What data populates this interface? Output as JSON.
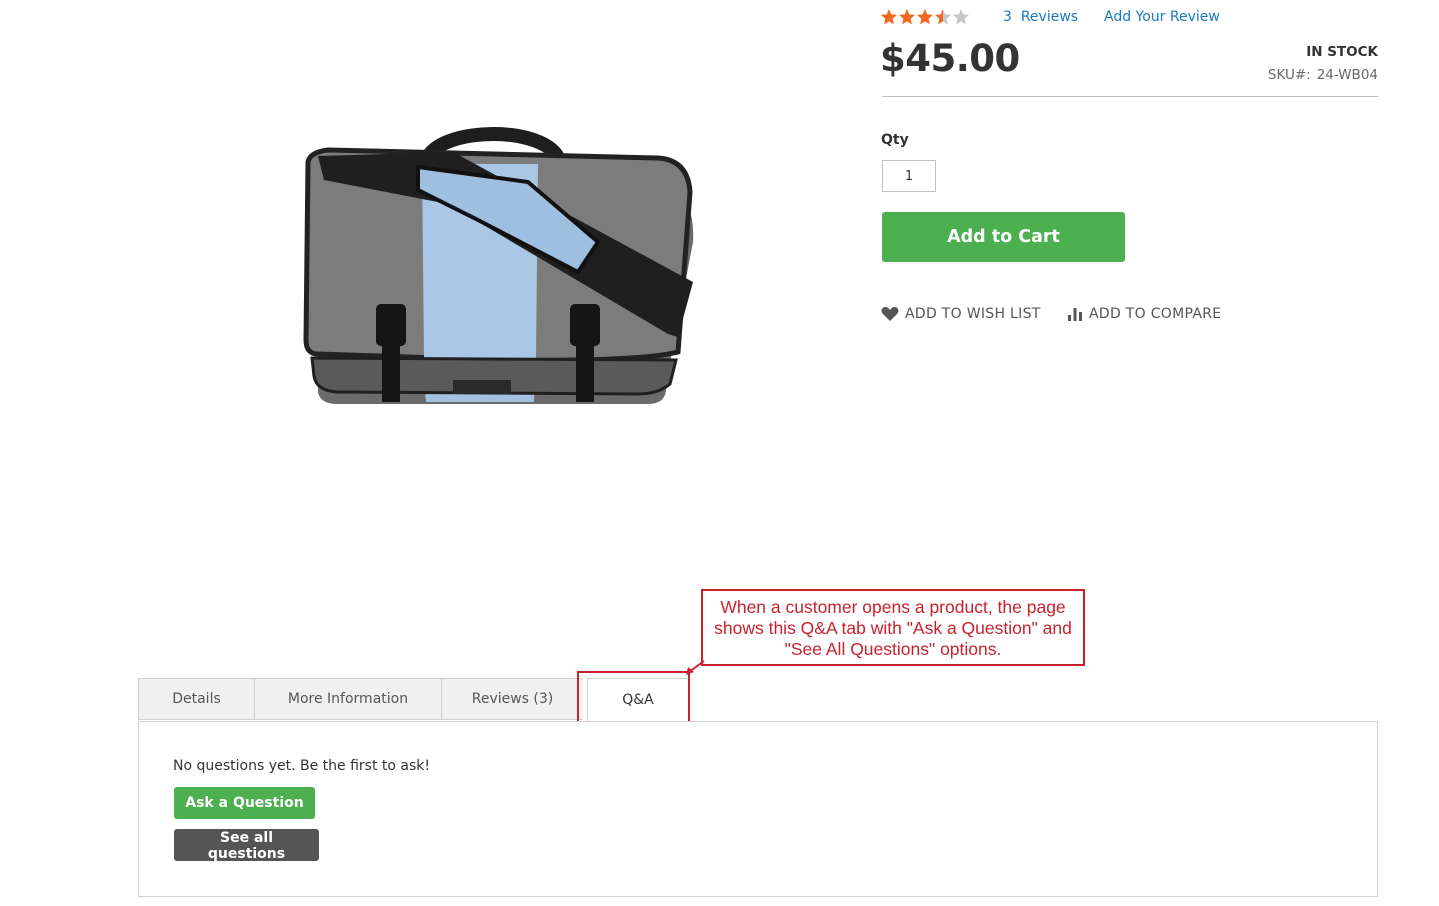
{
  "product": {
    "rating_out_of_5": 3.5,
    "reviews_count": "3",
    "reviews_label": "Reviews",
    "add_review_label": "Add Your Review",
    "price": "$45.00",
    "stock_status": "IN STOCK",
    "sku_label": "SKU#:",
    "sku_value": "24-WB04",
    "qty_label": "Qty",
    "qty_value": "1",
    "add_to_cart_label": "Add to Cart",
    "wishlist_label": "ADD TO WISH LIST",
    "compare_label": "ADD TO COMPARE",
    "icons": {
      "wishlist": "heart-icon",
      "compare": "compare-bars-icon",
      "rating": "star-icon"
    }
  },
  "tabs": [
    {
      "label": "Details"
    },
    {
      "label": "More Information"
    },
    {
      "label": "Reviews (3)"
    },
    {
      "label": "Q&A",
      "active": true
    }
  ],
  "qa_panel": {
    "empty_text": "No questions yet. Be the first to ask!",
    "ask_button_label": "Ask a Question",
    "see_all_button_label": "See all questions"
  },
  "annotation": {
    "text": "When a customer opens a product, the page shows this Q&A tab with \"Ask a Question\" and \"See All Questions\" options.",
    "color": "#c8222f"
  },
  "colors": {
    "primary_button": "#4caf50",
    "secondary_button": "#555555",
    "link": "#1979c3",
    "star_filled": "#f26722",
    "star_empty": "#c7c7c7"
  }
}
